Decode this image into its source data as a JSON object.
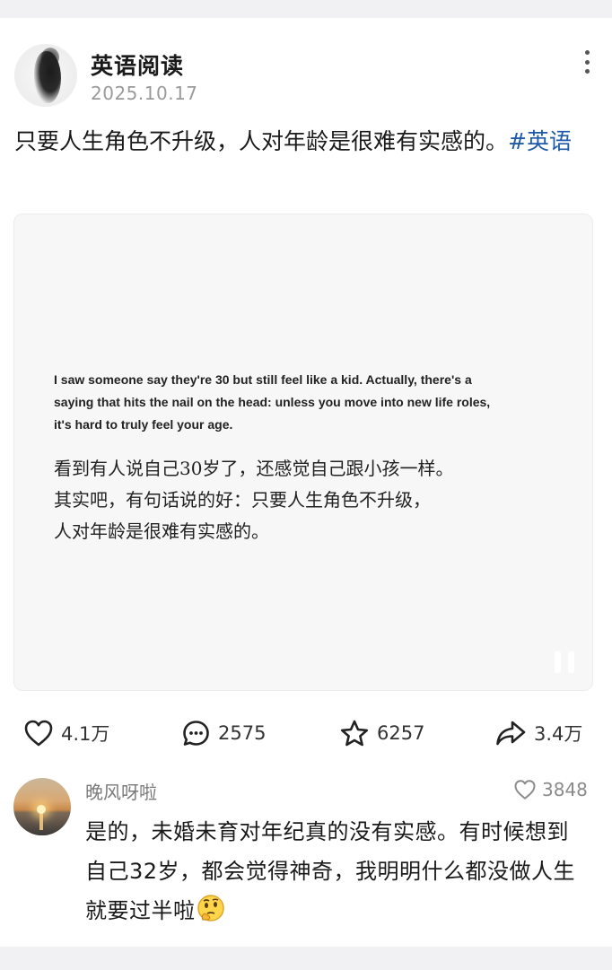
{
  "post": {
    "author": "英语阅读",
    "date": "2025.10.17",
    "text": "只要人生角色不升级，人对年龄是很难有实感的。",
    "hashtag": "#英语"
  },
  "image": {
    "english": "I saw someone say they're 30 but still feel like a kid. Actually, there's a saying that hits the nail on the head: unless you move into new life roles, it's hard to truly feel your age.",
    "chinese_lines": [
      "看到有人说自己30岁了，还感觉自己跟小孩一样。",
      "其实吧，有句话说的好：只要人生角色不升级，",
      "人对年龄是很难有实感的。"
    ]
  },
  "actions": {
    "likes": "4.1万",
    "comments": "2575",
    "favorites": "6257",
    "shares": "3.4万"
  },
  "comment": {
    "user": "晚风呀啦",
    "likes": "3848",
    "text": "是的，未婚未育对年纪真的没有实感。有时候想到自己32岁，都会觉得神奇，我明明什么都没做人生就要过半啦",
    "emoji": "thinking-face-emoji"
  },
  "colors": {
    "hashtag": "#1f5aa8",
    "secondary_text": "#9a9a9a",
    "background": "#f1f1f3"
  }
}
